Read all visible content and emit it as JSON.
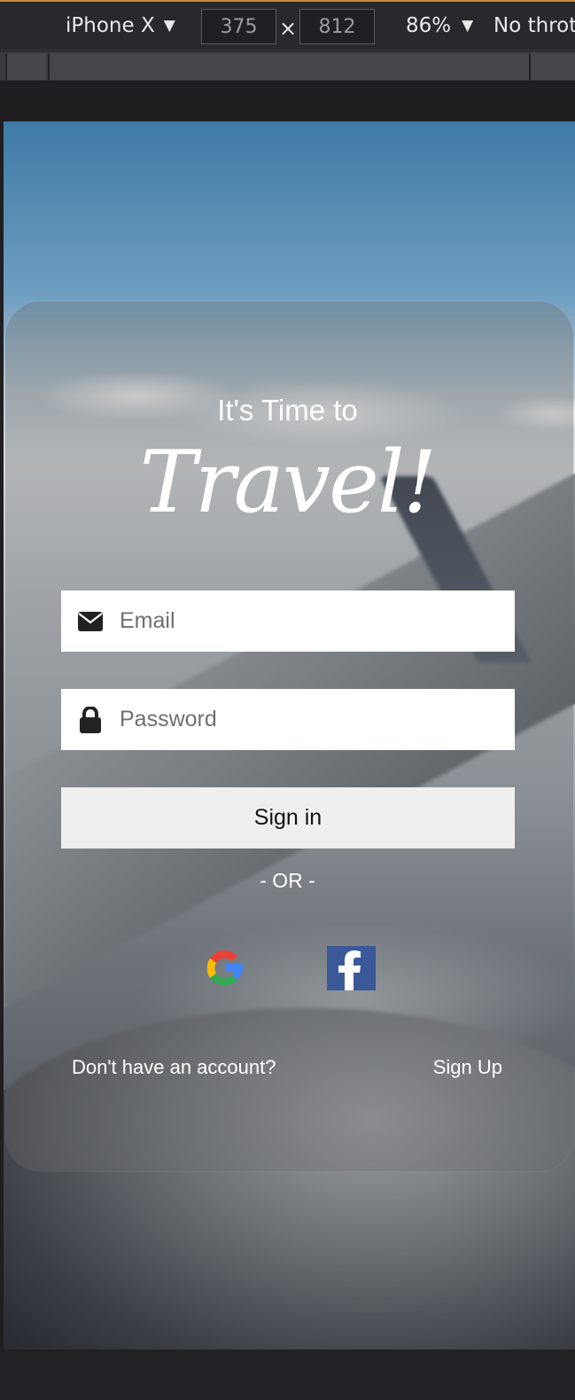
{
  "devtools": {
    "device": "iPhone X",
    "width": "375",
    "height": "812",
    "times": "×",
    "zoom": "86%",
    "throttle": "No throt",
    "caret": "▼"
  },
  "login": {
    "tagline": "It's Time to",
    "headline": "Travel!",
    "email_placeholder": "Email",
    "password_placeholder": "Password",
    "signin_label": "Sign in",
    "or_label": "- OR -",
    "no_account": "Don't have an account?",
    "signup_label": "Sign Up"
  },
  "icons": {
    "email": "envelope-icon",
    "password": "lock-icon",
    "google": "google-icon",
    "facebook": "facebook-icon"
  },
  "colors": {
    "facebook": "#3b5998",
    "signin_bg": "#efefef",
    "devtools_bg": "#28292c"
  }
}
